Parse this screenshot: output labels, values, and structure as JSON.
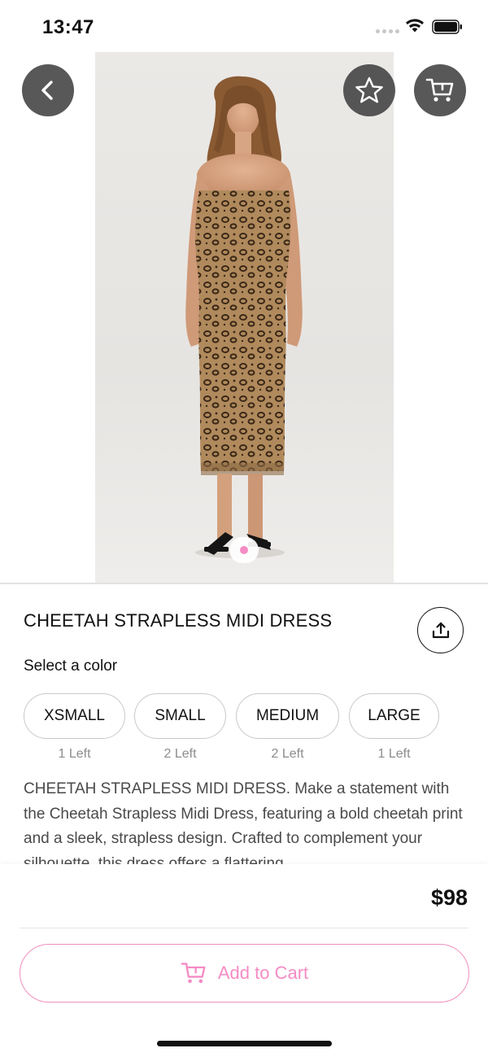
{
  "status_bar": {
    "time": "13:47"
  },
  "product": {
    "title": "CHEETAH STRAPLESS MIDI DRESS",
    "select_label": "Select a color",
    "sizes": [
      {
        "label": "XSMALL",
        "stock": "1 Left"
      },
      {
        "label": "SMALL",
        "stock": "2 Left"
      },
      {
        "label": "MEDIUM",
        "stock": "2 Left"
      },
      {
        "label": "LARGE",
        "stock": "1 Left"
      }
    ],
    "description": "CHEETAH STRAPLESS MIDI DRESS. Make a statement with the Cheetah Strapless Midi Dress, featuring a bold cheetah print and a sleek, strapless design. Crafted to complement your silhouette, this dress offers a flattering",
    "price": "$98",
    "image_page_indicator": {
      "current": 1,
      "total": 1
    }
  },
  "actions": {
    "add_to_cart_label": "Add to Cart"
  },
  "icons": {
    "back": "chevron-left-icon",
    "favorite": "star-icon",
    "cart": "cart-icon",
    "share": "share-icon",
    "add_to_cart": "cart-icon"
  },
  "colors": {
    "accent_pink": "#f58bc4",
    "overlay_button": "#3c3c3c",
    "text_primary": "#111111",
    "text_secondary": "#4a4a4a",
    "stock_gray": "#8c8c8c"
  }
}
